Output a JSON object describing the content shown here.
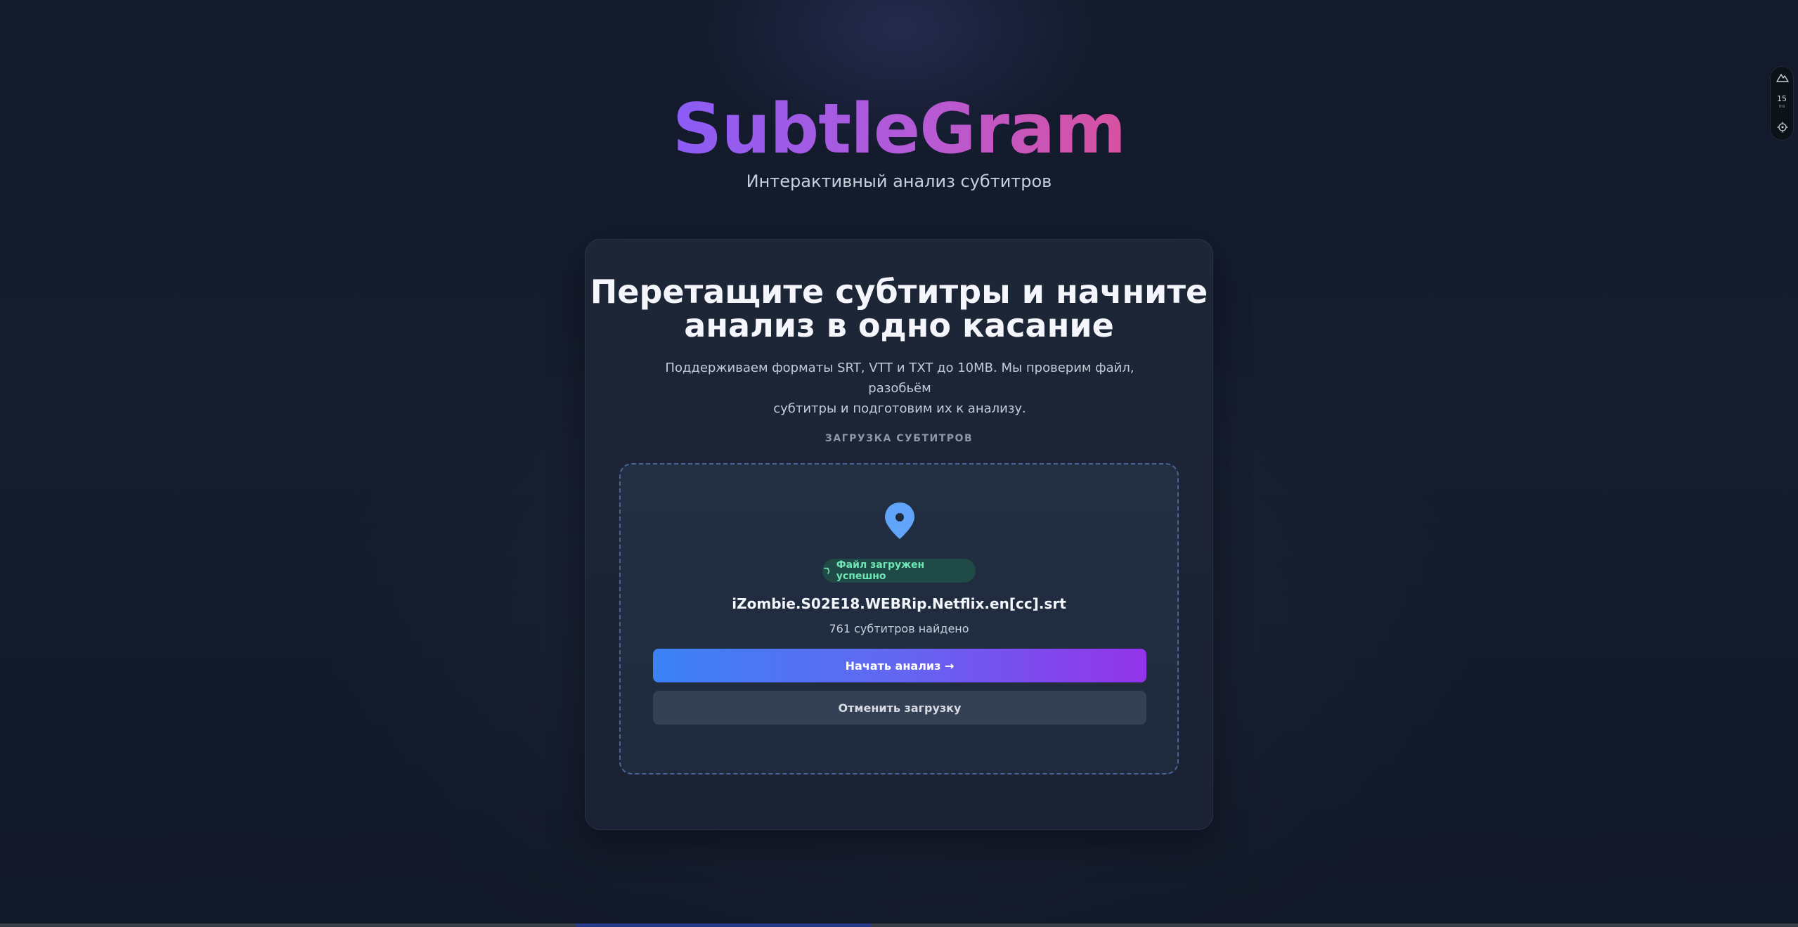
{
  "app": {
    "brand": "SubtleGram",
    "tagline": "Интерактивный анализ субтитров"
  },
  "card": {
    "title_line1": "Перетащите субтитры и начните",
    "title_line2": "анализ в одно касание",
    "desc_line1": "Поддерживаем форматы SRT, VTT и TXT до 10MB. Мы проверим файл, разобьём",
    "desc_line2": "субтитры и подготовим их к анализу.",
    "section_label": "ЗАГРУЗКА СУБТИТРОВ"
  },
  "upload": {
    "icon": "map-pin-icon",
    "status": "Файл загружен успешно",
    "status_icon": "check-icon",
    "file_name": "iZombie.S02E18.WEBRip.Netflix.en[cc].srt",
    "subtitle_count": "761 субтитров найдено",
    "start_button": "Начать анализ →",
    "cancel_button": "Отменить загрузку"
  },
  "side_widget": {
    "top_icon": "mountain-icon",
    "value": "15",
    "unit": "ms",
    "bottom_icon": "target-icon"
  },
  "colors": {
    "brand_gradient_start": "#8b5cf6",
    "brand_gradient_end": "#d9519f",
    "primary_gradient_start": "#3b82f6",
    "primary_gradient_end": "#9333ea",
    "success": "#6ee7b7",
    "pin": "#60a5fa"
  }
}
